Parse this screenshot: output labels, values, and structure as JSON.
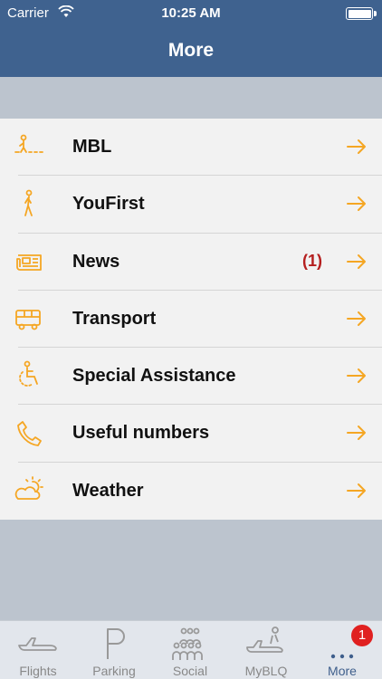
{
  "status": {
    "carrier": "Carrier",
    "time": "10:25 AM"
  },
  "nav": {
    "title": "More"
  },
  "menu": {
    "items": [
      {
        "label": "MBL",
        "badge": ""
      },
      {
        "label": "YouFirst",
        "badge": ""
      },
      {
        "label": "News",
        "badge": "(1)"
      },
      {
        "label": "Transport",
        "badge": ""
      },
      {
        "label": "Special Assistance",
        "badge": ""
      },
      {
        "label": "Useful numbers",
        "badge": ""
      },
      {
        "label": "Weather",
        "badge": ""
      }
    ]
  },
  "tabs": [
    {
      "label": "Flights"
    },
    {
      "label": "Parking"
    },
    {
      "label": "Social"
    },
    {
      "label": "MyBLQ"
    },
    {
      "label": "More",
      "badge": "1"
    }
  ],
  "colors": {
    "nav": "#3f628f",
    "accent": "#f5a623",
    "badge": "#b51f1f",
    "tab_badge": "#e02020"
  },
  "icons": {
    "menu": [
      "walkway-icon",
      "person-walking-icon",
      "newspaper-icon",
      "bus-icon",
      "wheelchair-icon",
      "phone-icon",
      "weather-icon"
    ],
    "tabs": [
      "airplane-icon",
      "parking-icon",
      "people-icon",
      "person-on-plane-icon",
      "more-dots-icon"
    ]
  }
}
